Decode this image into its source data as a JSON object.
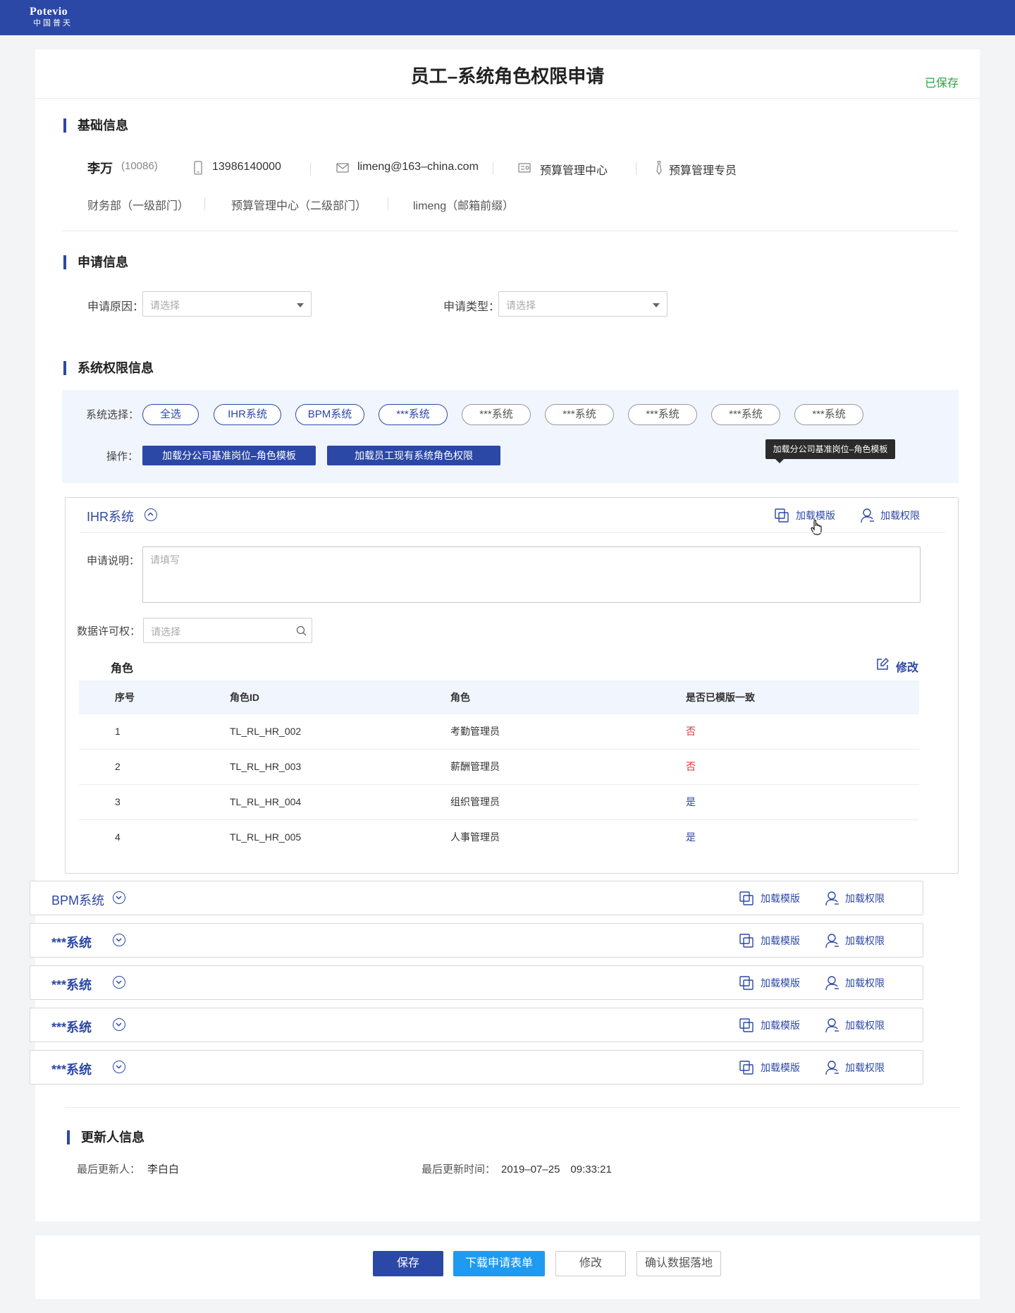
{
  "header": {
    "logo_top": "Potevio",
    "logo_bottom": "中国普天"
  },
  "page": {
    "title": "员工–系统角色权限申请",
    "status": "已保存"
  },
  "basic": {
    "section_title": "基础信息",
    "name": "李万",
    "emp_id": "(10086)",
    "phone": "13986140000",
    "email": "limeng@163–china.com",
    "center": "预算管理中心",
    "position": "预算管理专员",
    "dept1": "财务部（一级部门）",
    "dept2": "预算管理中心（二级部门）",
    "email_prefix": "limeng（邮箱前缀）"
  },
  "apply": {
    "section_title": "申请信息",
    "reason_label": "申请原因：",
    "reason_placeholder": "请选择",
    "type_label": "申请类型：",
    "type_placeholder": "请选择"
  },
  "perm": {
    "section_title": "系统权限信息",
    "sys_select_label": "系统选择：",
    "systems": [
      {
        "label": "全选",
        "selected": true
      },
      {
        "label": "IHR系统",
        "selected": true
      },
      {
        "label": "BPM系统",
        "selected": true
      },
      {
        "label": "***系统",
        "selected": true
      },
      {
        "label": "***系统",
        "selected": false
      },
      {
        "label": "***系统",
        "selected": false
      },
      {
        "label": "***系统",
        "selected": false
      },
      {
        "label": "***系统",
        "selected": false
      },
      {
        "label": "***系统",
        "selected": false
      }
    ],
    "op_label": "操作：",
    "op_load_template": "加载分公司基准岗位–角色模板",
    "op_load_current": "加载员工现有系统角色权限",
    "tooltip": "加载分公司基准岗位–角色模板"
  },
  "ihr": {
    "name": "IHR系统",
    "load_template": "加载模版",
    "load_perm": "加载权限",
    "desc_label": "申请说明：",
    "desc_placeholder": "请填写",
    "data_perm_label": "数据许可权：",
    "data_perm_placeholder": "请选择",
    "roles_title": "角色",
    "edit_label": "修改",
    "columns": [
      "序号",
      "角色ID",
      "角色",
      "是否已模版一致"
    ],
    "rows": [
      {
        "no": "1",
        "id": "TL_RL_HR_002",
        "role": "考勤管理员",
        "match": "否"
      },
      {
        "no": "2",
        "id": "TL_RL_HR_003",
        "role": "薪酬管理员",
        "match": "否"
      },
      {
        "no": "3",
        "id": "TL_RL_HR_004",
        "role": "组织管理员",
        "match": "是"
      },
      {
        "no": "4",
        "id": "TL_RL_HR_005",
        "role": "人事管理员",
        "match": "是"
      }
    ]
  },
  "collapsed_systems": [
    {
      "name": "BPM系统",
      "load_template": "加载模版",
      "load_perm": "加载权限"
    },
    {
      "name": "***系统",
      "load_template": "加载模版",
      "load_perm": "加载权限"
    },
    {
      "name": "***系统",
      "load_template": "加载模版",
      "load_perm": "加载权限"
    },
    {
      "name": "***系统",
      "load_template": "加载模版",
      "load_perm": "加载权限"
    },
    {
      "name": "***系统",
      "load_template": "加载模版",
      "load_perm": "加载权限"
    }
  ],
  "updater": {
    "section_title": "更新人信息",
    "last_updater_label": "最后更新人：",
    "last_updater": "李白白",
    "last_time_label": "最后更新时间：",
    "last_time": "2019–07–25　09:33:21"
  },
  "footer": {
    "save": "保存",
    "download": "下载申请表单",
    "edit": "修改",
    "confirm": "确认数据落地"
  },
  "colors": {
    "primary": "#2c48a6",
    "saved": "#29a745",
    "no": "#e0312f",
    "download": "#1e9bf0"
  }
}
